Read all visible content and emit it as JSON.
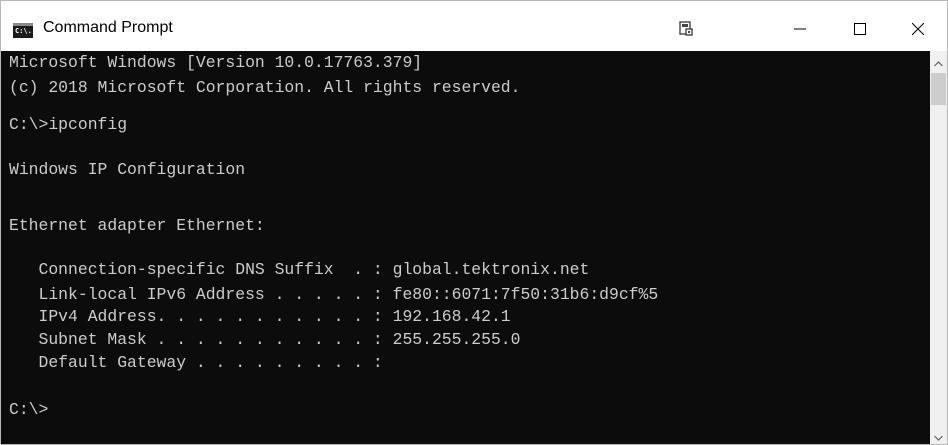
{
  "window": {
    "title": "Command Prompt",
    "icon_name": "cmd-app-icon",
    "icon_label": "C:\\."
  },
  "titlebar_buttons": {
    "properties_icon": "window-properties-icon",
    "minimize_icon": "minimize-icon",
    "maximize_icon": "maximize-icon",
    "close_icon": "close-icon"
  },
  "terminal": {
    "background": "#0c0c0c",
    "foreground": "#cccccc",
    "lines": [
      "Microsoft Windows [Version 10.0.17763.379]",
      "(c) 2018 Microsoft Corporation. All rights reserved.",
      "",
      "C:\\>ipconfig",
      "",
      "Windows IP Configuration",
      "",
      "",
      "Ethernet adapter Ethernet:",
      "",
      "   Connection-specific DNS Suffix  . : global.tektronix.net",
      "   Link-local IPv6 Address . . . . . : fe80::6071:7f50:31b6:d9cf%5",
      "   IPv4 Address. . . . . . . . . . . : 192.168.42.1",
      "   Subnet Mask . . . . . . . . . . . : 255.255.255.0",
      "   Default Gateway . . . . . . . . . :",
      "",
      "C:\\>"
    ]
  },
  "scrollbar": {
    "up_icon": "scroll-up-arrow-icon",
    "down_icon": "scroll-down-arrow-icon"
  }
}
